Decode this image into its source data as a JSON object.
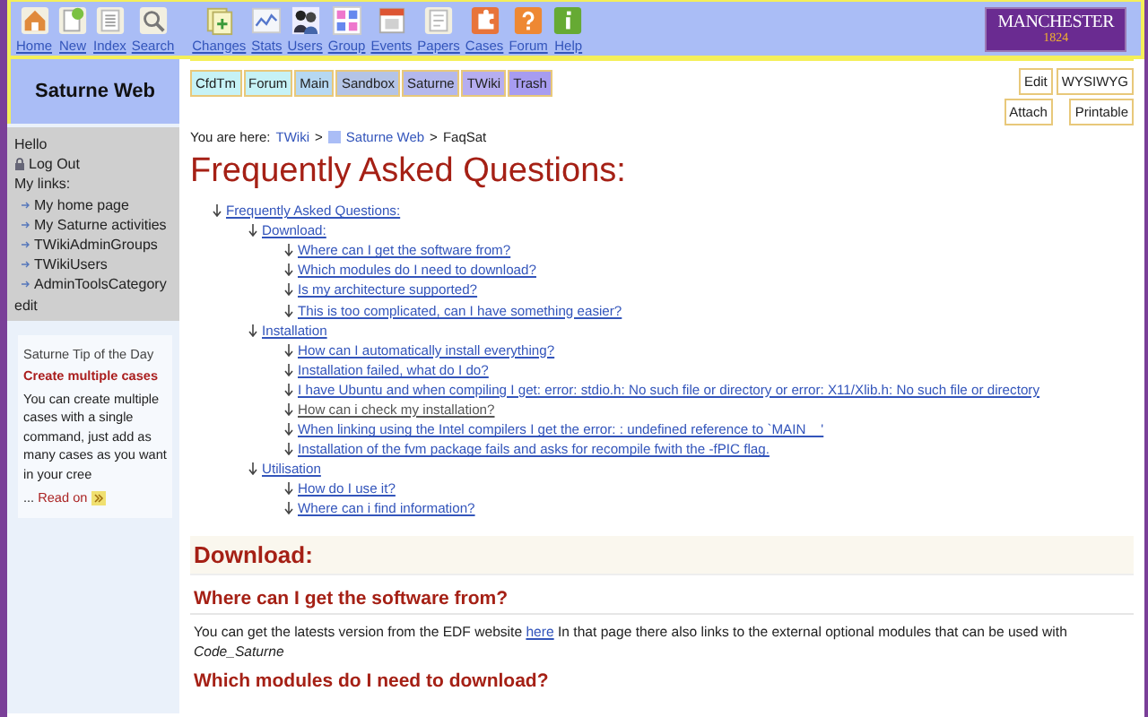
{
  "toolbar": [
    {
      "label": "Home"
    },
    {
      "label": "New"
    },
    {
      "label": "Index"
    },
    {
      "label": "Search"
    },
    {
      "label": "Changes"
    },
    {
      "label": "Stats"
    },
    {
      "label": "Users"
    },
    {
      "label": "Group"
    },
    {
      "label": "Events"
    },
    {
      "label": "Papers"
    },
    {
      "label": "Cases"
    },
    {
      "label": "Forum"
    },
    {
      "label": "Help"
    }
  ],
  "logo": {
    "name": "MANCHESTER",
    "year": "1824"
  },
  "web_title": "Saturne Web",
  "web_tabs": [
    {
      "label": "CfdTm",
      "color": "#c6f2f6"
    },
    {
      "label": "Forum",
      "color": "#c6f2f6"
    },
    {
      "label": "Main",
      "color": "#b6d8f2"
    },
    {
      "label": "Sandbox",
      "color": "#b4c4e6"
    },
    {
      "label": "Saturne",
      "color": "#b4b8ec"
    },
    {
      "label": "TWiki",
      "color": "#b6aef0"
    },
    {
      "label": "Trash",
      "color": "#a79cf0"
    }
  ],
  "actions": [
    "Edit",
    "WYSIWYG",
    "Attach",
    "Printable"
  ],
  "sidebar": {
    "greeting": "Hello",
    "logout": "Log Out",
    "links_heading": "My links:",
    "links": [
      "My home page",
      "My Saturne activities",
      "TWikiAdminGroups",
      "TWikiUsers",
      "AdminToolsCategory"
    ],
    "edit": "edit"
  },
  "tip": {
    "title": "Saturne Tip of the Day",
    "headline": "Create multiple cases",
    "body": "You can create multiple cases with a single command, just add as many cases as you want in your cree",
    "ellipsis": "...",
    "read_on": "Read on"
  },
  "breadcrumb": [
    {
      "kind": "plain",
      "text": "You are here:"
    },
    {
      "kind": "link",
      "text": "TWiki"
    },
    {
      "kind": "plain",
      "text": ">"
    },
    {
      "kind": "web",
      "text": "Saturne Web"
    },
    {
      "kind": "plain",
      "text": ">"
    },
    {
      "kind": "plain",
      "text": "FaqSat"
    }
  ],
  "title": "Frequently Asked Questions:",
  "toc": [
    {
      "label": "Frequently Asked Questions:",
      "visited": false,
      "children": [
        {
          "label": "Download:",
          "visited": false,
          "children": [
            {
              "label": "Where can I get the software from?",
              "visited": false
            },
            {
              "label": "Which modules do I need to download?",
              "visited": false
            },
            {
              "label": "Is my architecture supported?",
              "visited": false
            },
            {
              "label": "This is too complicated, can I have something easier?",
              "visited": false
            }
          ]
        },
        {
          "label": "Installation",
          "visited": false,
          "children": [
            {
              "label": "How can I automatically install everything?",
              "visited": false
            },
            {
              "label": "Installation failed, what do I do?",
              "visited": false
            },
            {
              "label": "I have Ubuntu and when compiling I get: error: stdio.h: No such file or directory or error: X11/Xlib.h: No such file or directory",
              "visited": false
            },
            {
              "label": "How can i check my installation?",
              "visited": true
            },
            {
              "label": "When linking using the Intel compilers I get the error: : undefined reference to `MAIN__'",
              "visited": false
            },
            {
              "label": "Installation of the fvm package fails and asks for recompile fwith the -fPIC flag.",
              "visited": false
            }
          ]
        },
        {
          "label": "Utilisation",
          "visited": false,
          "children": [
            {
              "label": "How do I use it?",
              "visited": false
            },
            {
              "label": "Where can i find information?",
              "visited": false
            }
          ]
        }
      ]
    }
  ],
  "sections": [
    {
      "kind": "h2",
      "text": "Download:"
    },
    {
      "kind": "h3",
      "text": "Where can I get the software from?"
    },
    {
      "kind": "para",
      "before": "You can get the latests version from the EDF website",
      "link": "here",
      "after": "In that page there also links to the external optional modules that can be used with *Code_Saturne*"
    },
    {
      "kind": "h3",
      "text": "Which modules do I need to download?"
    }
  ]
}
